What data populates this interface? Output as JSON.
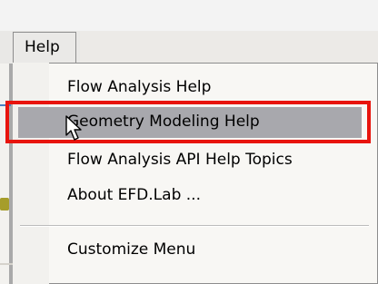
{
  "menu": {
    "title": "Help",
    "items": [
      {
        "label": "Flow Analysis Help"
      },
      {
        "label": "Geometry Modeling Help"
      },
      {
        "label": "Flow Analysis API Help Topics"
      },
      {
        "label": "About EFD.Lab ..."
      },
      {
        "label": "Customize Menu"
      }
    ]
  },
  "colors": {
    "highlight": "#a8a8ad",
    "annotation_box": "#e8140d"
  },
  "icons": {
    "cursor": "mouse-pointer-icon"
  }
}
